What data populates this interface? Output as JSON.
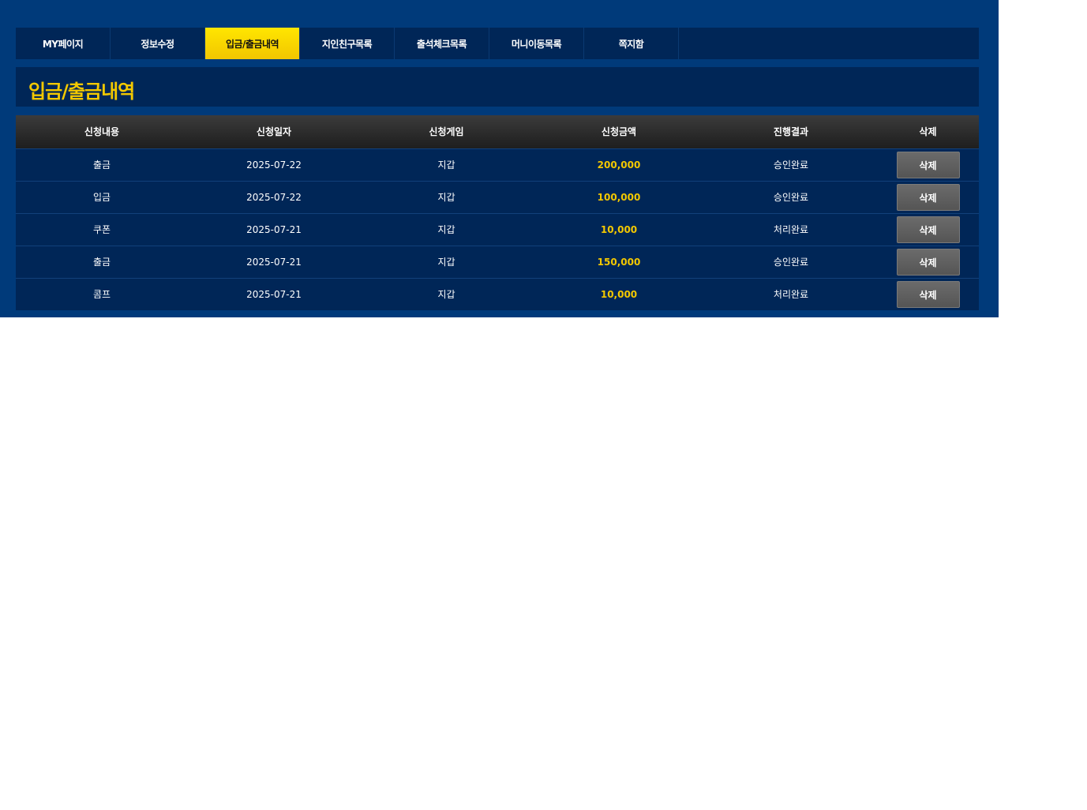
{
  "tabs": [
    {
      "label": "MY페이지",
      "active": false
    },
    {
      "label": "정보수정",
      "active": false
    },
    {
      "label": "입금/출금내역",
      "active": true
    },
    {
      "label": "지인친구목록",
      "active": false
    },
    {
      "label": "출석체크목록",
      "active": false
    },
    {
      "label": "머니이동목록",
      "active": false
    },
    {
      "label": "쪽지함",
      "active": false
    }
  ],
  "page_title": "입금/출금내역",
  "table": {
    "headers": [
      "신청내용",
      "신청일자",
      "신청게임",
      "신청금액",
      "진행결과",
      "삭제"
    ],
    "rows": [
      {
        "type": "출금",
        "date": "2025-07-22",
        "game": "지갑",
        "amount": "200,000",
        "result": "승인완료",
        "delete_label": "삭제"
      },
      {
        "type": "입금",
        "date": "2025-07-22",
        "game": "지갑",
        "amount": "100,000",
        "result": "승인완료",
        "delete_label": "삭제"
      },
      {
        "type": "쿠폰",
        "date": "2025-07-21",
        "game": "지갑",
        "amount": "10,000",
        "result": "처리완료",
        "delete_label": "삭제"
      },
      {
        "type": "출금",
        "date": "2025-07-21",
        "game": "지갑",
        "amount": "150,000",
        "result": "승인완료",
        "delete_label": "삭제"
      },
      {
        "type": "콤프",
        "date": "2025-07-21",
        "game": "지갑",
        "amount": "10,000",
        "result": "처리완료",
        "delete_label": "삭제"
      }
    ]
  },
  "colors": {
    "panel_bg": "#003a7a",
    "bar_bg": "#002657",
    "accent_yellow": "#f3c800",
    "active_tab": "#ffe600",
    "header_dark": "#2b2b2b",
    "delete_button": "#606060"
  }
}
